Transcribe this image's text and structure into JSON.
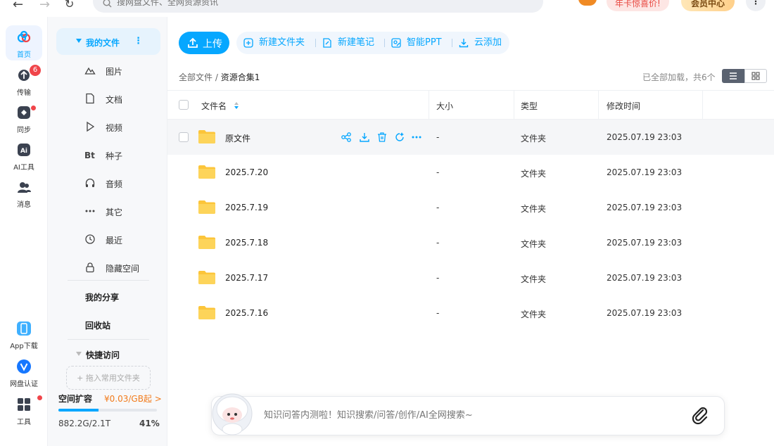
{
  "topbar": {
    "search_placeholder": "搜网盘文件、全网资源资讯",
    "promo_label": "年卡惊喜价!",
    "vip_label": "会员中心",
    "more_label": "⋮"
  },
  "rail": {
    "items": [
      {
        "label": "首页"
      },
      {
        "label": "传输",
        "badge": "6"
      },
      {
        "label": "同步"
      },
      {
        "label": "AI工具"
      },
      {
        "label": "消息"
      },
      {
        "label": "App下载"
      },
      {
        "label": "网盘认证"
      },
      {
        "label": "工具"
      }
    ]
  },
  "sidebar": {
    "my_files": "我的文件",
    "items": [
      {
        "label": "图片"
      },
      {
        "label": "文档"
      },
      {
        "label": "视频"
      },
      {
        "label": "种子"
      },
      {
        "label": "音频"
      },
      {
        "label": "其它"
      },
      {
        "label": "最近"
      },
      {
        "label": "隐藏空间"
      }
    ],
    "my_share": "我的分享",
    "recycle": "回收站",
    "quick_access": "快捷访问",
    "add_common": "+ 拖入常用文件夹",
    "space_title": "空间扩容",
    "space_price": "¥0.03/GB起 >",
    "space_used": "882.2G/2.1T",
    "space_percent": "41%",
    "space_fraction": 0.41
  },
  "toolbar": {
    "upload": "上传",
    "new_folder": "新建文件夹",
    "new_note": "新建笔记",
    "smart_ppt": "智能PPT",
    "cloud_add": "云添加"
  },
  "breadcrumb": {
    "root": "全部文件",
    "sep": " / ",
    "current": "资源合集1"
  },
  "loaded_text": "已全部加载，共6个",
  "table": {
    "headers": {
      "name": "文件名",
      "size": "大小",
      "type": "类型",
      "mtime": "修改时间"
    },
    "rows": [
      {
        "name": "原文件",
        "size": "-",
        "type": "文件夹",
        "mtime": "2025.07.19 23:03"
      },
      {
        "name": "2025.7.20",
        "size": "-",
        "type": "文件夹",
        "mtime": "2025.07.19 23:03"
      },
      {
        "name": "2025.7.19",
        "size": "-",
        "type": "文件夹",
        "mtime": "2025.07.19 23:03"
      },
      {
        "name": "2025.7.18",
        "size": "-",
        "type": "文件夹",
        "mtime": "2025.07.19 23:03"
      },
      {
        "name": "2025.7.17",
        "size": "-",
        "type": "文件夹",
        "mtime": "2025.07.19 23:03"
      },
      {
        "name": "2025.7.16",
        "size": "-",
        "type": "文件夹",
        "mtime": "2025.07.19 23:03"
      }
    ]
  },
  "ai_bar": {
    "placeholder": "知识问答内测啦！知识搜索/问答/创作/AI全网搜索~"
  },
  "colors": {
    "accent": "#06a7ff",
    "folder": "#fcc53a",
    "badge": "#f0454a",
    "price": "#f27a1a"
  }
}
